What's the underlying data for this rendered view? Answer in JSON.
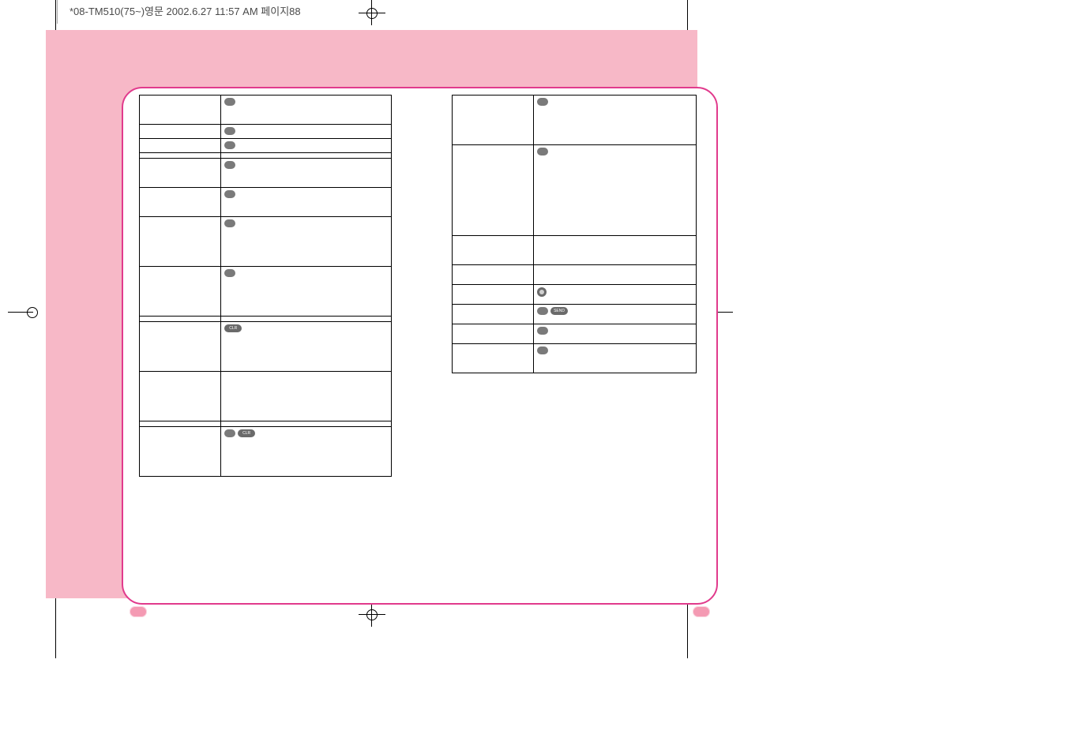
{
  "file_header": "*08-TM510(75~)영문  2002.6.27 11:57 AM  페이지88",
  "keys": {
    "clr": "CLR",
    "send": "SEND",
    "pound": "#"
  },
  "left_table": {
    "rows": [
      {
        "h": "tall1",
        "c1": "",
        "c2_icons": [
          "oval"
        ]
      },
      {
        "h": "",
        "c1": "",
        "c2_icons": [
          "oval"
        ]
      },
      {
        "h": "",
        "c1": "",
        "c2_icons": [
          "oval"
        ]
      },
      {
        "h": "",
        "c1": "",
        "c2_icons": []
      },
      {
        "h": "tall1",
        "c1": "",
        "c2_icons": [
          "oval"
        ]
      },
      {
        "h": "tall1",
        "c1": "",
        "c2_icons": [
          "oval"
        ]
      },
      {
        "h": "tall2",
        "c1": "",
        "c2_icons": [
          "oval"
        ]
      },
      {
        "h": "tall2",
        "c1": "",
        "c2_icons": [
          "oval"
        ]
      },
      {
        "h": "",
        "c1": "",
        "c2_icons": []
      },
      {
        "h": "tall2",
        "c1": "",
        "c2_icons": [
          "clr"
        ]
      },
      {
        "h": "tall2",
        "c1": "",
        "c2_icons": []
      },
      {
        "h": "",
        "c1": "",
        "c2_icons": []
      },
      {
        "h": "tall2",
        "c1": "",
        "c2_icons": [
          "oval",
          "clr"
        ]
      }
    ]
  },
  "right_table": {
    "rows": [
      {
        "h": "tall2",
        "c1": "",
        "c2_icons": [
          "oval"
        ]
      },
      {
        "h": "tall3",
        "c1": "",
        "c2_icons": [
          "oval"
        ]
      },
      {
        "h": "tall1",
        "c1": "",
        "c2_icons": []
      },
      {
        "h": "tall4",
        "c1": "",
        "c2_icons": []
      },
      {
        "h": "tall4",
        "c1": "",
        "c2_icons": [
          "round"
        ]
      },
      {
        "h": "tall4",
        "c1": "",
        "c2_icons": [
          "oval",
          "send"
        ]
      },
      {
        "h": "tall4",
        "c1": "",
        "c2_icons": [
          "oval"
        ]
      },
      {
        "h": "tall1",
        "c1": "",
        "c2_icons": [
          "oval"
        ]
      }
    ]
  }
}
